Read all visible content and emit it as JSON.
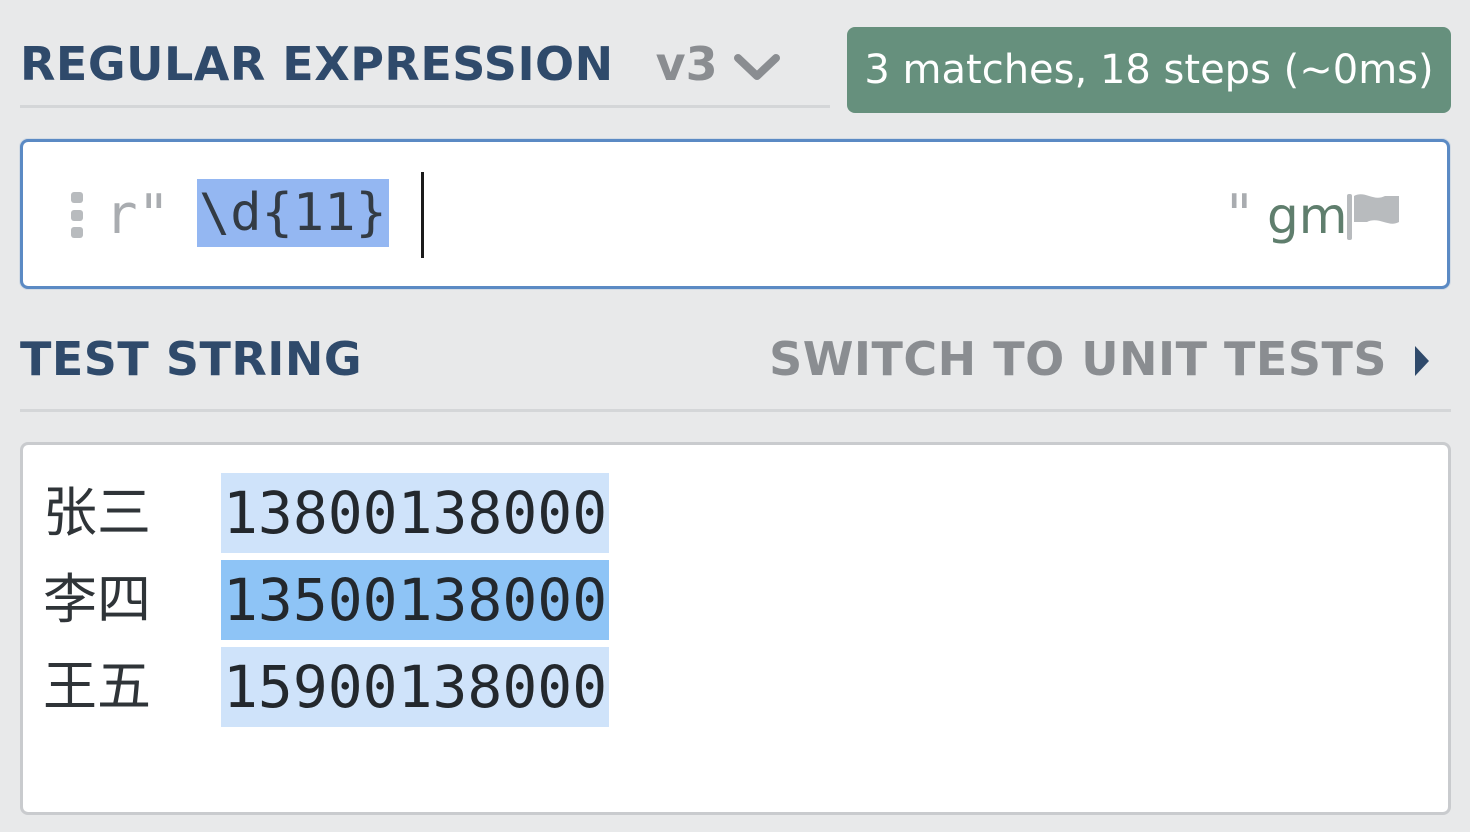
{
  "regex_section": {
    "title": "REGULAR EXPRESSION",
    "flavor": "v3",
    "flavor_icon": "chevron-down-icon"
  },
  "match_info": "3 matches, 18 steps (~0ms)",
  "regex_input": {
    "delimiter_open": "r\"",
    "pattern": "\\d{11}",
    "delimiter_close": "\"",
    "flags": "gm",
    "flag_icon": "flag-icon",
    "selection_color": "#94b7f2"
  },
  "test_section": {
    "title": "TEST STRING",
    "switch_label": "SWITCH TO UNIT TESTS",
    "switch_icon": "triangle-right-icon"
  },
  "test_lines": [
    {
      "name": "张三",
      "number": "13800138000"
    },
    {
      "name": "李四",
      "number": "13500138000"
    },
    {
      "name": "王五",
      "number": "15900138000"
    }
  ],
  "colors": {
    "match_badge": "#66907d",
    "match_highlight": "#cfe3fa",
    "match_highlight_active": "#8ec4f6",
    "title": "#2f4a6b",
    "input_border": "#5b8ac4"
  }
}
